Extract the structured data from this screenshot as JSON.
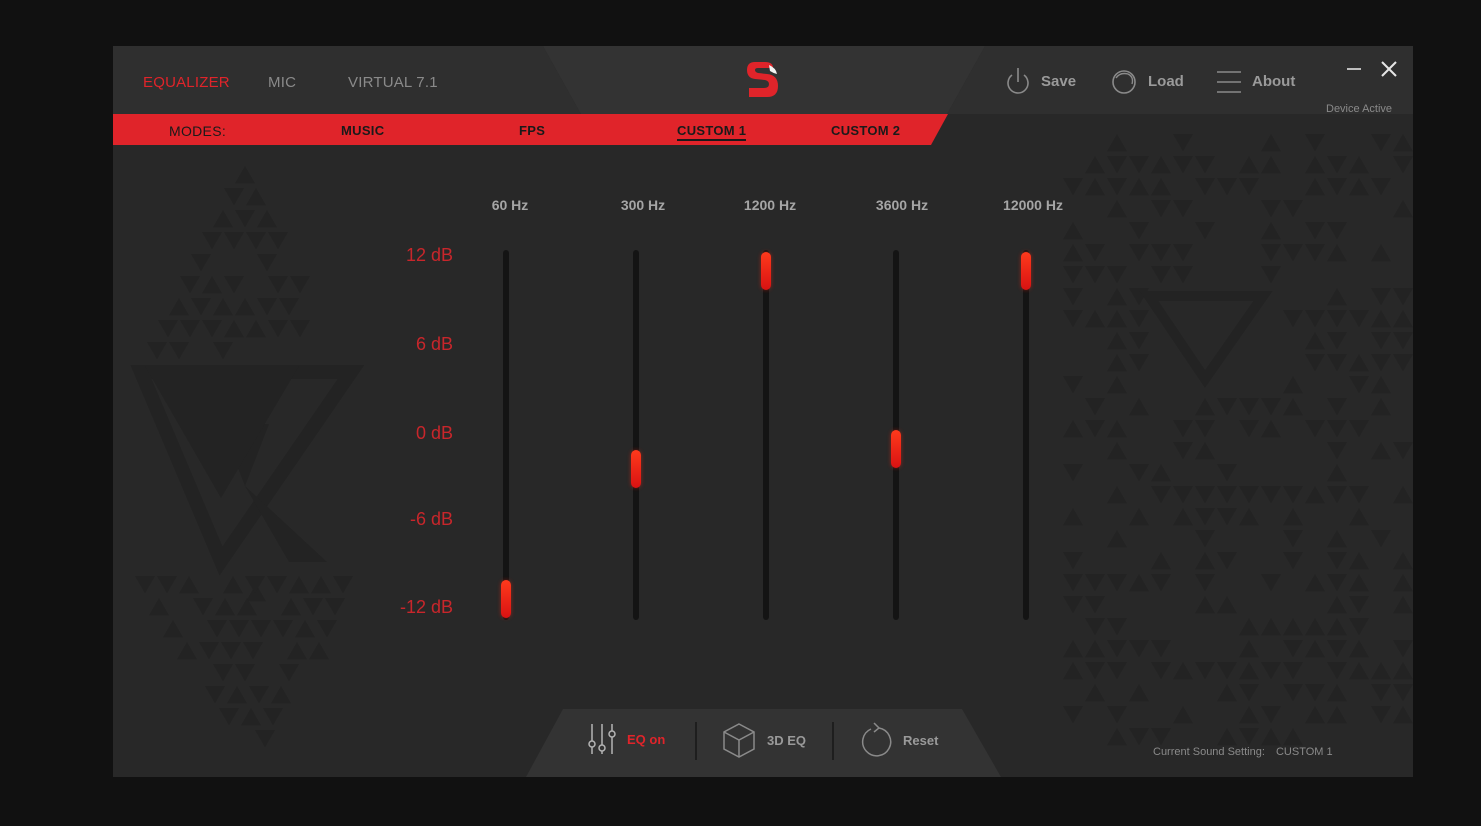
{
  "nav": {
    "tabs": [
      {
        "label": "EQUALIZER",
        "active": true
      },
      {
        "label": "MIC",
        "active": false
      },
      {
        "label": "VIRTUAL 7.1",
        "active": false
      }
    ]
  },
  "toolbar": {
    "save_label": "Save",
    "load_label": "Load",
    "about_label": "About",
    "device_status": "Device Active"
  },
  "modes": {
    "label": "MODES:",
    "items": [
      {
        "label": "MUSIC",
        "active": false
      },
      {
        "label": "FPS",
        "active": false
      },
      {
        "label": "CUSTOM 1",
        "active": true
      },
      {
        "label": "CUSTOM 2",
        "active": false
      }
    ]
  },
  "equalizer": {
    "db_scale": [
      "12 dB",
      "6 dB",
      "0 dB",
      "-6 dB",
      "-12 dB"
    ],
    "bands": [
      {
        "frequency": "60 Hz",
        "gain_db": -12
      },
      {
        "frequency": "300 Hz",
        "gain_db": -2.5
      },
      {
        "frequency": "1200 Hz",
        "gain_db": 12
      },
      {
        "frequency": "3600 Hz",
        "gain_db": -1
      },
      {
        "frequency": "12000 Hz",
        "gain_db": 12
      }
    ],
    "range_db": [
      -12,
      12
    ]
  },
  "bottom": {
    "eq_on_label": "EQ on",
    "eq_3d_label": "3D EQ",
    "reset_label": "Reset",
    "current_setting_label": "Current Sound Setting:",
    "current_setting_value": "CUSTOM 1"
  },
  "colors": {
    "accent": "#e0242a",
    "window_bg": "#282828",
    "header_bg": "#2f2f2f",
    "slider_track": "#141414"
  },
  "icons": {
    "save": "power-icon",
    "load": "load-swirl-icon",
    "about": "hamburger-menu-icon",
    "eq_on": "sliders-icon",
    "eq_3d": "cube-icon",
    "reset": "reset-icon",
    "minimize": "minimize-icon",
    "close": "close-icon",
    "logo": "brand-logo"
  }
}
